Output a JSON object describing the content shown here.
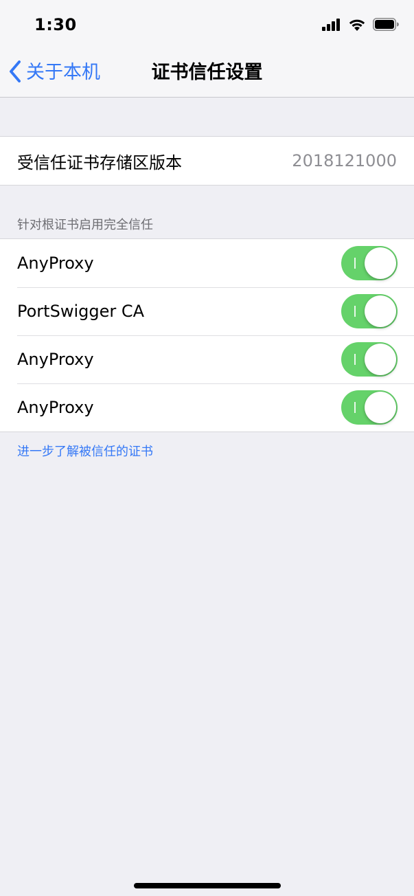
{
  "status_bar": {
    "time": "1:30",
    "icons": [
      "cellular-signal-icon",
      "wifi-icon",
      "battery-icon"
    ]
  },
  "nav": {
    "back_label": "关于本机",
    "back_icon": "chevron-left-icon",
    "title": "证书信任设置"
  },
  "trust_store": {
    "label": "受信任证书存储区版本",
    "value": "2018121000"
  },
  "certificates_section": {
    "header": "针对根证书启用完全信任",
    "items": [
      {
        "label": "AnyProxy",
        "enabled": true
      },
      {
        "label": "PortSwigger CA",
        "enabled": true
      },
      {
        "label": "AnyProxy",
        "enabled": true
      },
      {
        "label": "AnyProxy",
        "enabled": true
      }
    ]
  },
  "footer": {
    "link": "进一步了解被信任的证书"
  },
  "colors": {
    "accent": "#3478f6",
    "toggle_on": "#65d26a",
    "background": "#efeff4"
  }
}
